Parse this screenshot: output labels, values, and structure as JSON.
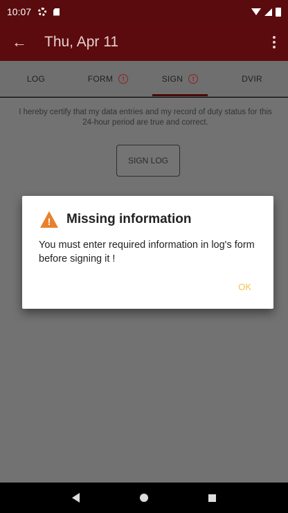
{
  "status_bar": {
    "time": "10:07",
    "icons": [
      "settings-icon",
      "sd-card-icon",
      "wifi-icon",
      "signal-icon",
      "battery-icon"
    ]
  },
  "app_bar": {
    "title": "Thu, Apr 11",
    "back_icon": "back-arrow-icon",
    "menu_icon": "overflow-menu-icon"
  },
  "tabs": [
    {
      "label": "LOG",
      "warning": false
    },
    {
      "label": "FORM",
      "warning": true
    },
    {
      "label": "SIGN",
      "warning": true,
      "active": true
    },
    {
      "label": "DVIR",
      "warning": false
    }
  ],
  "content": {
    "certification_text": "I hereby certify that my data entries and my record of duty status for this 24-hour period are true and correct.",
    "sign_button_label": "SIGN LOG"
  },
  "dialog": {
    "title": "Missing information",
    "message": "You must enter required information in log's form before signing it !",
    "ok_label": "OK"
  },
  "colors": {
    "app_bar": "#5b0b0d",
    "warning_orange": "#e8812c",
    "ok_button": "#f5c24a"
  },
  "nav_bar": {
    "icons": [
      "back-triangle-icon",
      "home-circle-icon",
      "recents-square-icon"
    ]
  }
}
